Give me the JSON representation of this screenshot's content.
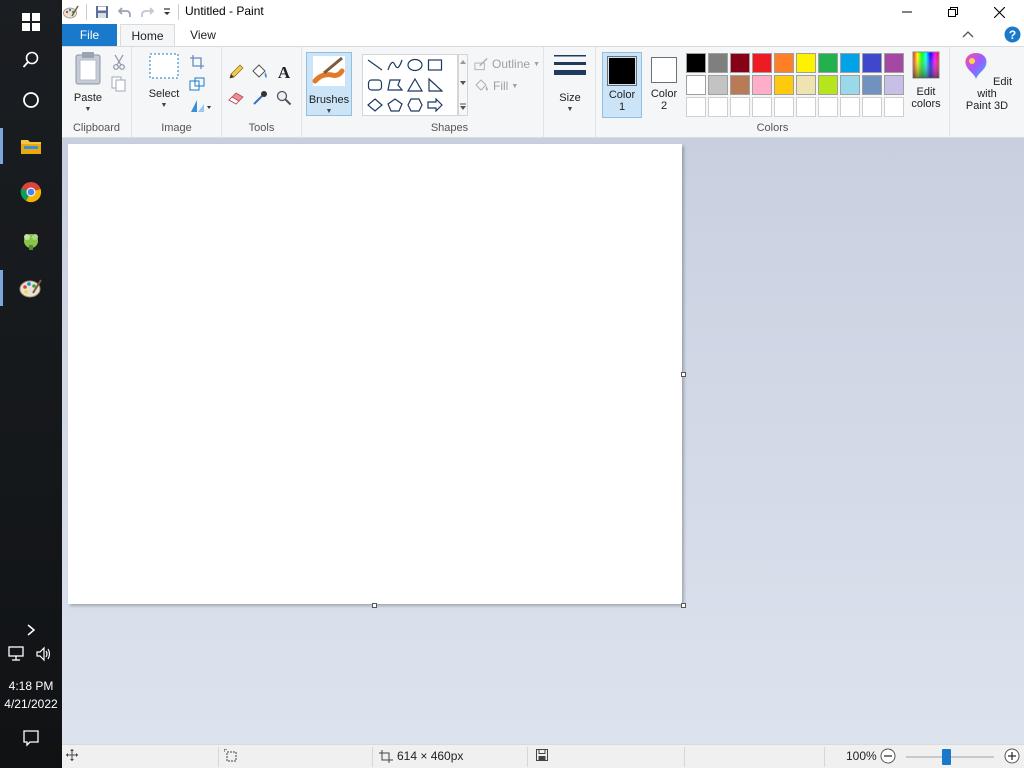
{
  "window": {
    "title": "Untitled - Paint"
  },
  "tabs": [
    {
      "label": "File"
    },
    {
      "label": "Home"
    },
    {
      "label": "View"
    }
  ],
  "ribbon": {
    "clipboard": {
      "group_label": "Clipboard",
      "paste_label": "Paste"
    },
    "image": {
      "group_label": "Image",
      "select_label": "Select"
    },
    "tools": {
      "group_label": "Tools"
    },
    "brushes": {
      "label": "Brushes"
    },
    "shapes": {
      "group_label": "Shapes",
      "outline_label": "Outline",
      "fill_label": "Fill"
    },
    "size": {
      "label": "Size"
    },
    "colors": {
      "group_label": "Colors",
      "color1_label": "Color 1",
      "color1_line1": "Color",
      "color1_line2": "1",
      "color2_line1": "Color",
      "color2_line2": "2",
      "color1_value": "#000000",
      "color2_value": "#ffffff",
      "edit_line1": "Edit",
      "edit_line2": "colors",
      "paint3d_line1": "Edit with",
      "paint3d_line2": "Paint 3D",
      "palette_row1": [
        "#000000",
        "#7f7f7f",
        "#880015",
        "#ed1c24",
        "#ff7f27",
        "#fff200",
        "#22b14c",
        "#00a2e8",
        "#3f48cc",
        "#a349a4"
      ],
      "palette_row2": [
        "#ffffff",
        "#c3c3c3",
        "#b97a57",
        "#ffaec9",
        "#ffc90e",
        "#efe4b0",
        "#b5e61d",
        "#99d9ea",
        "#7092be",
        "#c8bfe7"
      ],
      "palette_row3": [
        "#ffffff",
        "#ffffff",
        "#ffffff",
        "#ffffff",
        "#ffffff",
        "#ffffff",
        "#ffffff",
        "#ffffff",
        "#ffffff",
        "#ffffff"
      ]
    }
  },
  "statusbar": {
    "canvas_size": "614 × 460px",
    "zoom": "100%",
    "zoom_fraction": 0.45
  },
  "taskbar": {
    "time": "4:18 PM",
    "date": "4/21/2022"
  }
}
